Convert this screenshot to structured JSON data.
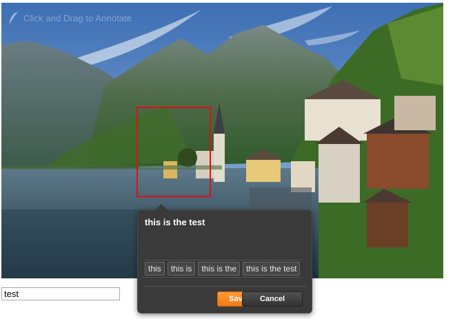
{
  "photo": {
    "hint_label": "Click and Drag to Annotate",
    "hint_icon": "feather-icon"
  },
  "annotation": {
    "text": "this is the test",
    "tags": [
      "this",
      "this is",
      "this is the",
      "this is the test"
    ],
    "save_label": "Save",
    "cancel_label": "Cancel"
  },
  "colors": {
    "selection": "#e01010",
    "save_button": "#f58220",
    "tooltip_bg": "#3a3a3a"
  },
  "input": {
    "value": "test"
  }
}
